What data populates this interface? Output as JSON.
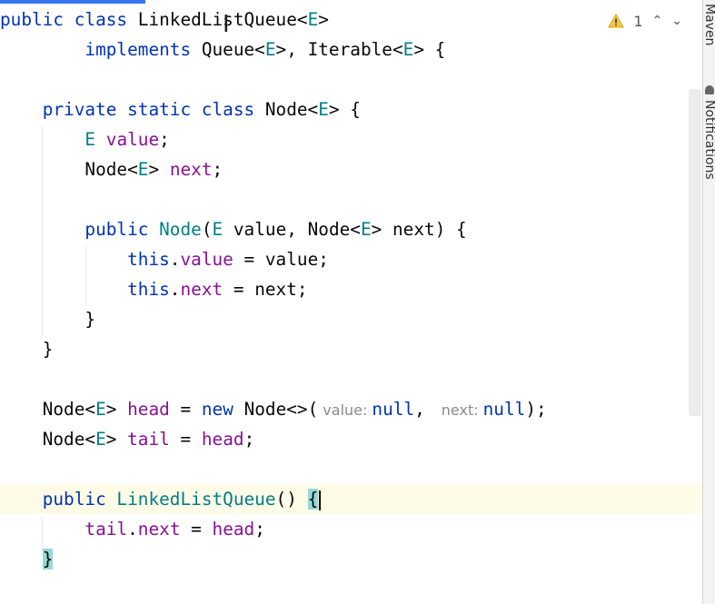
{
  "editor": {
    "lines": {
      "l1": {
        "p1": "public class ",
        "p2": "LinkedListQueue<",
        "p3": "E",
        "p4": ">"
      },
      "l2": {
        "p1": "        implements ",
        "p2": "Queue<",
        "p3": "E",
        "p4": ">, Iterable<",
        "p5": "E",
        "p6": "> {"
      },
      "l4": {
        "p1": "    private static class ",
        "p2": "Node<",
        "p3": "E",
        "p4": "> {"
      },
      "l5": {
        "p1": "        ",
        "p2": "E",
        "p3": " ",
        "p4": "value",
        "p5": ";"
      },
      "l6": {
        "p1": "        Node<",
        "p2": "E",
        "p3": "> ",
        "p4": "next",
        "p5": ";"
      },
      "l8": {
        "p1": "        public ",
        "p2": "Node",
        "p3": "(",
        "p4": "E",
        "p5": " value, Node<",
        "p6": "E",
        "p7": "> next) {"
      },
      "l9": {
        "p1": "            ",
        "p2": "this",
        "p3": ".",
        "p4": "value",
        "p5": " = value;"
      },
      "l10": {
        "p1": "            ",
        "p2": "this",
        "p3": ".",
        "p4": "next",
        "p5": " = next;"
      },
      "l11": {
        "p1": "        }"
      },
      "l12": {
        "p1": "    }"
      },
      "l14": {
        "p1": "    Node<",
        "p2": "E",
        "p3": "> ",
        "p4": "head",
        "p5": " = ",
        "p6": "new",
        "p7": " Node<>(",
        "hint1": "value:",
        "p8": "null",
        "p9": ",",
        "hint2": "next:",
        "p10": "null",
        "p11": ");"
      },
      "l15": {
        "p1": "    Node<",
        "p2": "E",
        "p3": "> ",
        "p4": "tail",
        "p5": " = ",
        "p6": "head",
        "p7": ";"
      },
      "l17": {
        "p1": "    public ",
        "p2": "LinkedListQueue",
        "p3": "() ",
        "p4": "{"
      },
      "l18": {
        "p1": "        ",
        "p2": "tail",
        "p3": ".",
        "p4": "next",
        "p5": " = ",
        "p6": "head",
        "p7": ";"
      },
      "l19": {
        "p1": "    ",
        "p2": "}"
      }
    }
  },
  "inspection": {
    "warning_count": "1",
    "icon": "warning-triangle-icon",
    "up_icon": "chevron-up-icon",
    "down_icon": "chevron-down-icon",
    "up": "⌃",
    "down": "⌄"
  },
  "side_panel": {
    "maven_label": "Maven",
    "notifications_label": "Notifications"
  },
  "colors": {
    "keyword": "#0033b3",
    "type_param": "#007e8a",
    "field": "#871094",
    "warning": "#f2c94c",
    "current_line": "#fefbe6",
    "brace_match": "#93d9d9"
  }
}
